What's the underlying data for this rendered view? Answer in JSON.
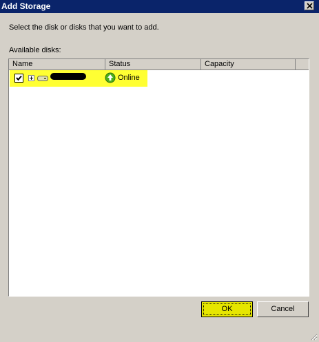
{
  "window": {
    "title": "Add Storage"
  },
  "instruction": "Select the disk or disks that you want to add.",
  "available_label": "Available disks:",
  "table": {
    "columns": [
      "Name",
      "Status",
      "Capacity"
    ],
    "rows": [
      {
        "checked": true,
        "name": "",
        "status": "Online",
        "capacity": ""
      }
    ]
  },
  "buttons": {
    "ok": "OK",
    "cancel": "Cancel"
  },
  "colors": {
    "titlebar": "#0a246a",
    "highlight": "#ffff33",
    "status_icon": "#4caf1a"
  },
  "icons": [
    "close-icon",
    "checkbox-checked",
    "expand-plus-icon",
    "disk-icon",
    "online-status-icon",
    "resize-grip-icon"
  ]
}
